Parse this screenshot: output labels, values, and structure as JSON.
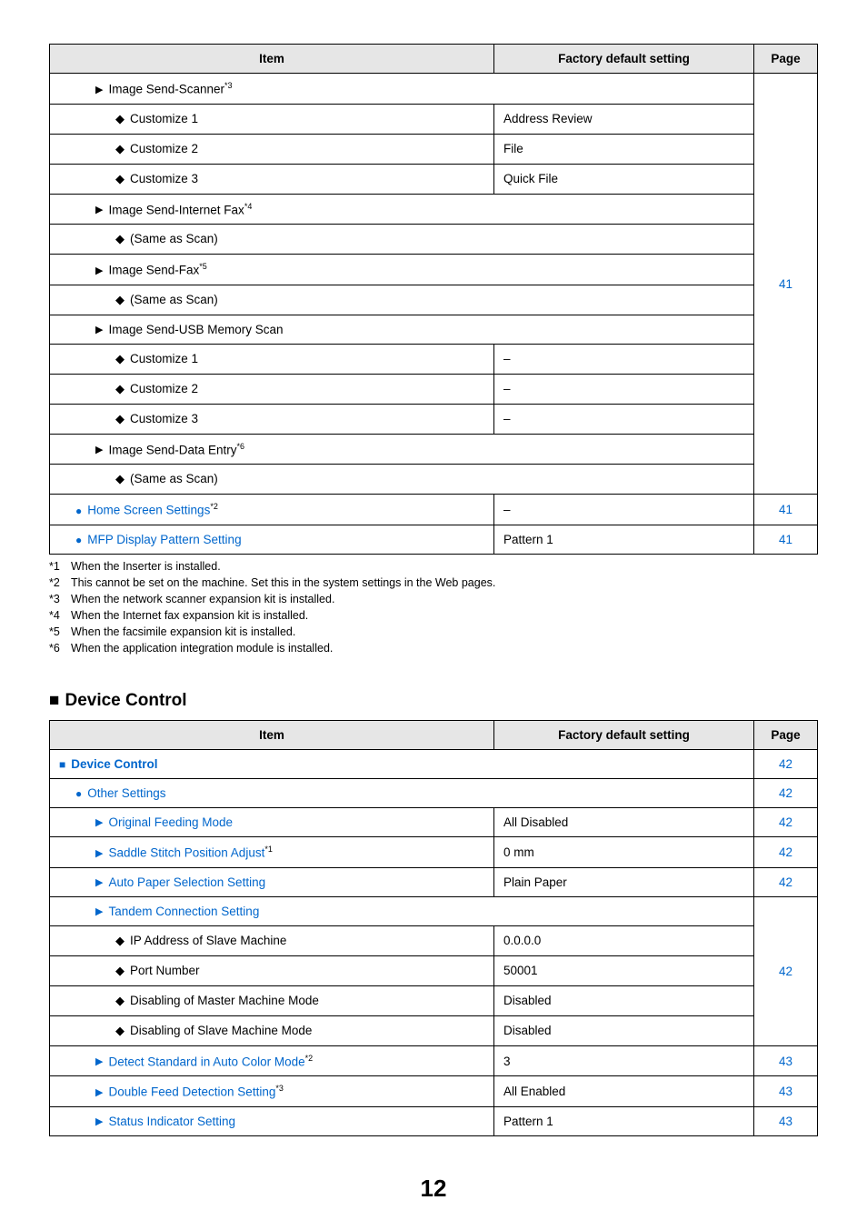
{
  "table1": {
    "headers": {
      "item": "Item",
      "factory": "Factory default setting",
      "page": "Page"
    },
    "group_page": "41",
    "rows": {
      "img_scanner_label": "Image Send-Scanner",
      "img_scanner_sup": "*3",
      "c1": "Customize 1",
      "c1v": "Address Review",
      "c2": "Customize 2",
      "c2v": "File",
      "c3": "Customize 3",
      "c3v": "Quick File",
      "inet_fax": "Image Send-Internet Fax",
      "inet_fax_sup": "*4",
      "same1": "(Same as Scan)",
      "send_fax": "Image Send-Fax",
      "send_fax_sup": "*5",
      "same2": "(Same as Scan)",
      "usb": "Image Send-USB Memory Scan",
      "uc1": "Customize 1",
      "uc1v": "–",
      "uc2": "Customize 2",
      "uc2v": "–",
      "uc3": "Customize 3",
      "uc3v": "–",
      "data_entry": "Image Send-Data Entry",
      "data_entry_sup": "*6",
      "same3": "(Same as Scan)"
    },
    "home_label": "Home Screen Settings",
    "home_sup": "*2",
    "home_v": "–",
    "home_page": "41",
    "mfp_label": "MFP Display Pattern Setting",
    "mfp_v": "Pattern 1",
    "mfp_page": "41"
  },
  "footnotes": {
    "f1k": "*1",
    "f1v": "When the Inserter is installed.",
    "f2k": "*2",
    "f2v": "This cannot be set on the machine. Set this in the system settings in the Web pages.",
    "f3k": "*3",
    "f3v": "When the network scanner expansion kit is installed.",
    "f4k": "*4",
    "f4v": "When the Internet fax expansion kit is installed.",
    "f5k": "*5",
    "f5v": "When the facsimile expansion kit is installed.",
    "f6k": "*6",
    "f6v": "When the application integration module is installed."
  },
  "section2_heading": "Device Control",
  "table2": {
    "headers": {
      "item": "Item",
      "factory": "Factory default setting",
      "page": "Page"
    },
    "device_control": "Device Control",
    "device_control_page": "42",
    "other": "Other Settings",
    "other_page": "42",
    "orig_feed": "Original Feeding Mode",
    "orig_feed_v": "All Disabled",
    "orig_feed_page": "42",
    "saddle": "Saddle Stitch Position Adjust",
    "saddle_sup": "*1",
    "saddle_v": "0 mm",
    "saddle_page": "42",
    "auto_paper": "Auto Paper Selection Setting",
    "auto_paper_v": "Plain Paper",
    "auto_paper_page": "42",
    "tandem": "Tandem Connection Setting",
    "tandem_page": "42",
    "ip": "IP Address of Slave Machine",
    "ip_v": "0.0.0.0",
    "port": "Port Number",
    "port_v": "50001",
    "dis_master": "Disabling of Master Machine Mode",
    "dis_master_v": "Disabled",
    "dis_slave": "Disabling of Slave Machine Mode",
    "dis_slave_v": "Disabled",
    "detect": "Detect Standard in Auto Color Mode",
    "detect_sup": "*2",
    "detect_v": "3",
    "detect_page": "43",
    "dfeed": "Double Feed Detection Setting",
    "dfeed_sup": "*3",
    "dfeed_v": "All Enabled",
    "dfeed_page": "43",
    "status": "Status Indicator Setting",
    "status_v": "Pattern 1",
    "status_page": "43"
  },
  "page_number": "12"
}
